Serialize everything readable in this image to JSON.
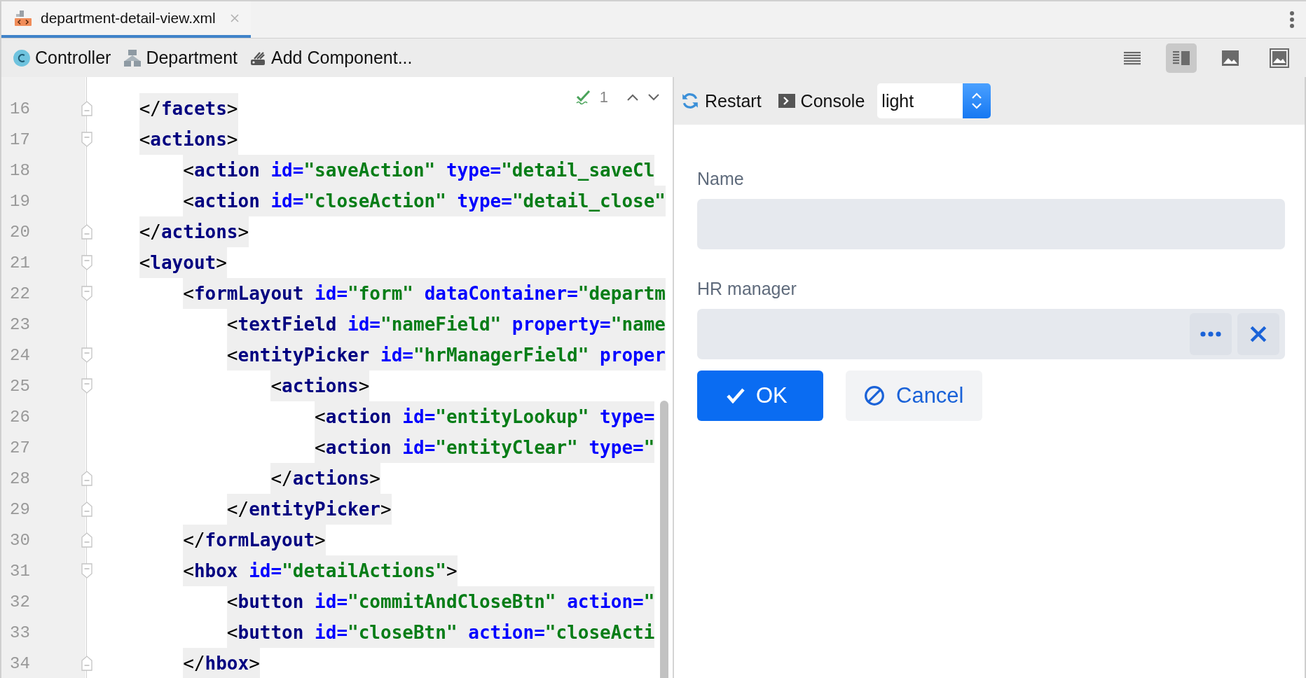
{
  "tabs": [
    {
      "label": "department-detail-view.xml",
      "selected": true
    }
  ],
  "toolbar": {
    "items": [
      {
        "kind": "controller",
        "label": "Controller"
      },
      {
        "kind": "entity",
        "label": "Department"
      },
      {
        "kind": "add",
        "label": "Add Component..."
      }
    ],
    "view_modes": [
      {
        "kind": "text",
        "selected": false
      },
      {
        "kind": "split",
        "selected": true
      },
      {
        "kind": "preview",
        "selected": false
      },
      {
        "kind": "framed",
        "selected": false
      }
    ]
  },
  "editor": {
    "inspection_count": "1",
    "lines": [
      {
        "number": "16",
        "text": "    </facets>",
        "kind": "fold-end"
      },
      {
        "number": "17",
        "text": "    <actions>",
        "kind": "fold-start"
      },
      {
        "number": "18",
        "text": "        <action id=\"saveAction\" type=\"detail_saveCl",
        "kind": "plain"
      },
      {
        "number": "19",
        "text": "        <action id=\"closeAction\" type=\"detail_close\"",
        "kind": "plain"
      },
      {
        "number": "20",
        "text": "    </actions>",
        "kind": "fold-end"
      },
      {
        "number": "21",
        "text": "    <layout>",
        "kind": "fold-start"
      },
      {
        "number": "22",
        "text": "        <formLayout id=\"form\" dataContainer=\"departm",
        "kind": "fold-start"
      },
      {
        "number": "23",
        "text": "            <textField id=\"nameField\" property=\"name",
        "kind": "plain"
      },
      {
        "number": "24",
        "text": "            <entityPicker id=\"hrManagerField\" proper",
        "kind": "fold-start"
      },
      {
        "number": "25",
        "text": "                <actions>",
        "kind": "fold-start"
      },
      {
        "number": "26",
        "text": "                    <action id=\"entityLookup\" type=",
        "kind": "plain"
      },
      {
        "number": "27",
        "text": "                    <action id=\"entityClear\" type=\"",
        "kind": "plain"
      },
      {
        "number": "28",
        "text": "                </actions>",
        "kind": "fold-end"
      },
      {
        "number": "29",
        "text": "            </entityPicker>",
        "kind": "fold-end"
      },
      {
        "number": "30",
        "text": "        </formLayout>",
        "kind": "fold-end"
      },
      {
        "number": "31",
        "text": "        <hbox id=\"detailActions\">",
        "kind": "fold-start"
      },
      {
        "number": "32",
        "text": "            <button id=\"commitAndCloseBtn\" action=\"",
        "kind": "plain"
      },
      {
        "number": "33",
        "text": "            <button id=\"closeBtn\" action=\"closeActi",
        "kind": "plain"
      },
      {
        "number": "34",
        "text": "        </hbox>",
        "kind": "fold-end"
      }
    ]
  },
  "preview": {
    "toolbar": {
      "restart": "Restart",
      "console": "Console",
      "theme": "light"
    },
    "fields": [
      {
        "kind": "text",
        "label": "Name"
      },
      {
        "kind": "picker",
        "label": "HR manager"
      }
    ],
    "buttons": [
      {
        "kind": "primary",
        "label": "OK"
      },
      {
        "kind": "secondary",
        "label": "Cancel"
      }
    ]
  }
}
